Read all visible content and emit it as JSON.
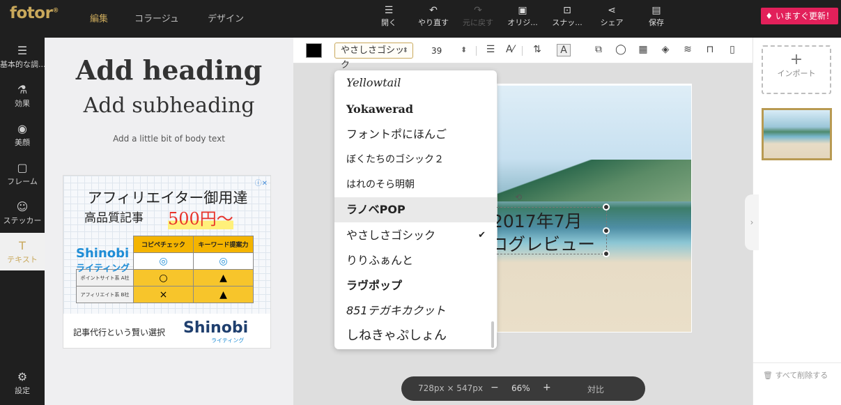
{
  "app": {
    "logo": "fotor",
    "logo_mark": "®"
  },
  "nav": {
    "tabs": [
      "編集",
      "コラージュ",
      "デザイン"
    ],
    "active": "編集"
  },
  "toolbar": {
    "buttons": [
      {
        "label": "開く",
        "icon": "menu-icon"
      },
      {
        "label": "やり直す",
        "icon": "undo-icon"
      },
      {
        "label": "元に戻す",
        "icon": "redo-icon"
      },
      {
        "label": "オリジ...",
        "icon": "original-icon"
      },
      {
        "label": "スナッ...",
        "icon": "snapshot-icon"
      },
      {
        "label": "シェア",
        "icon": "share-icon"
      },
      {
        "label": "保存",
        "icon": "save-icon"
      }
    ],
    "upgrade_label": "いますぐ更新！"
  },
  "rail": {
    "items": [
      {
        "label": "基本的な調...",
        "icon": "sliders-icon"
      },
      {
        "label": "効果",
        "icon": "flask-icon"
      },
      {
        "label": "美顔",
        "icon": "eye-icon"
      },
      {
        "label": "フレーム",
        "icon": "frame-icon"
      },
      {
        "label": "ステッカー",
        "icon": "sticker-icon"
      },
      {
        "label": "テキスト",
        "icon": "text-icon"
      }
    ],
    "settings_label": "設定"
  },
  "text_panel": {
    "heading": "Add heading",
    "subheading": "Add subheading",
    "body": "Add a little bit of body text"
  },
  "ad": {
    "line1": "アフィリエイター御用達",
    "line2": "高品質記事",
    "price": "500円～",
    "logo": "Shinobi",
    "logo_sub": "ライティング",
    "col1": "コピペチェック",
    "col2": "キーワード提案力",
    "row1_label": "ポイントサイト系\nA社",
    "row2_label": "アフィリエイト系\nB社",
    "marks": {
      "r0c1": "◎",
      "r0c2": "◎",
      "r1c1": "○",
      "r1c2": "▲",
      "r2c1": "×",
      "r2c2": "▲"
    },
    "tagline": "記事代行という賢い選択",
    "brand": "Shinobi",
    "brand_sub": "ライティング"
  },
  "text_toolbar": {
    "color": "#000000",
    "font": "やさしさゴシック",
    "size": "39"
  },
  "font_dropdown": {
    "items": [
      "Yellowtail",
      "Yokawerad",
      "フォントポにほんご",
      "ぼくたちのゴシック２",
      "はれのそら明朝",
      "ラノベPOP",
      "やさしさゴシック",
      "りりふぁんと",
      "ラヴポップ",
      "851テガキカクット",
      "しねきゃぷしょん"
    ],
    "hovered": "ラノベPOP",
    "selected": "やさしさゴシック",
    "check": "✔"
  },
  "canvas": {
    "text_line1": "2017年7月",
    "text_line2": "ブログレビュー"
  },
  "zoom": {
    "size": "728px × 547px",
    "minus": "−",
    "level": "66%",
    "plus": "+",
    "compare": "対比"
  },
  "right_sidebar": {
    "import_label": "インポート",
    "delete_all": "すべて削除する"
  },
  "colors": {
    "accent": "#c9a85b",
    "upgrade": "#e2205a",
    "topbar": "#1f1f1f"
  }
}
